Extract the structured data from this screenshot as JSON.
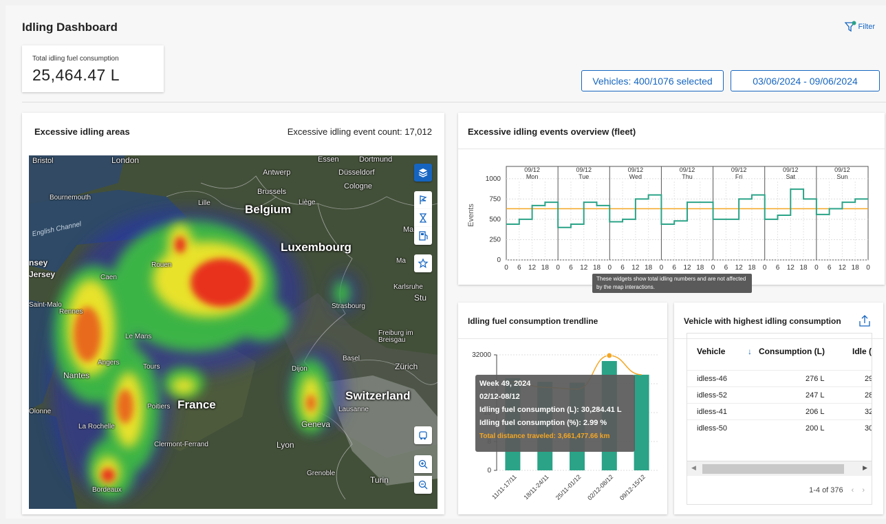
{
  "header": {
    "title": "Idling Dashboard",
    "filter_label": "Filter"
  },
  "kpi": {
    "label": "Total idling fuel consumption",
    "value": "25,464.47 L"
  },
  "selectors": {
    "vehicles": "Vehicles: 400/1076 selected",
    "date_range": "03/06/2024 - 09/06/2024"
  },
  "map": {
    "title": "Excessive idling areas",
    "event_count": "Excessive idling event count: 17,012",
    "countries": [
      "Belgium",
      "Luxembourg",
      "France",
      "Switzerland"
    ],
    "cities": [
      "Bristol",
      "London",
      "Antwerp",
      "Essen",
      "Dortmund",
      "Düsseldorf",
      "Cologne",
      "Brussels",
      "Lille",
      "Liège",
      "Bournemouth",
      "Rouen",
      "Caen",
      "Jersey",
      "nsey",
      "Saint-Malo",
      "Rennes",
      "Le Mans",
      "Angers",
      "Tours",
      "Nantes",
      "Poitiers",
      "La Rochelle",
      "Clermont-Ferrand",
      "Lyon",
      "Grenoble",
      "Turin",
      "Geneva",
      "Lausanne",
      "Dijon",
      "Basel",
      "Zürich",
      "Freiburg im Breisgau",
      "Strasbourg",
      "Karlsruhe",
      "Stu",
      "Bordeaux",
      "Olonne",
      "Ma",
      "Mar"
    ],
    "sea": "English Channel",
    "controls": [
      "layers-icon",
      "flag-icon",
      "hourglass-icon",
      "fuel-icon",
      "star-icon",
      "vehicle-icon",
      "zoom-in-icon",
      "zoom-out-icon"
    ]
  },
  "overview": {
    "title": "Excessive idling events overview (fleet)",
    "tooltip": "These widgets show total idling numbers and are not affected by the map interactions.",
    "colors": {
      "series": "#2aa387",
      "threshold": "#f5a623"
    }
  },
  "trend": {
    "title": "Idling fuel consumption trendline",
    "tooltip": {
      "week": "Week 49, 2024",
      "range": "02/12-08/12",
      "consumption_l": "Idling fuel consumption (L): 30,284.41 L",
      "consumption_pct": "Idling fuel consumption (%): 2.99 %",
      "distance": "Total distance traveled: 3,661,477.66 km"
    }
  },
  "vehicle_table": {
    "title": "Vehicle with highest idling consumption",
    "columns": [
      "Vehicle",
      "Consumption (L)",
      "Idle ("
    ],
    "sort_icon": "arrow-down-icon",
    "rows": [
      {
        "vehicle": "idless-46",
        "consumption": "276 L",
        "idle": "29"
      },
      {
        "vehicle": "idless-52",
        "consumption": "247 L",
        "idle": "28"
      },
      {
        "vehicle": "idless-41",
        "consumption": "206 L",
        "idle": "32"
      },
      {
        "vehicle": "idless-50",
        "consumption": "200 L",
        "idle": "30"
      }
    ],
    "pagination": "1-4 of 376"
  },
  "chart_data": [
    {
      "type": "line",
      "title": "Excessive idling events overview (fleet)",
      "ylabel": "Events",
      "ylim": [
        0,
        1100
      ],
      "yticks": [
        0,
        250,
        500,
        750,
        1000
      ],
      "xticks": [
        "0",
        "6",
        "12",
        "18"
      ],
      "days": [
        {
          "date": "09/12",
          "day": "Mon"
        },
        {
          "date": "09/12",
          "day": "Tue"
        },
        {
          "date": "09/12",
          "day": "Wed"
        },
        {
          "date": "09/12",
          "day": "Thu"
        },
        {
          "date": "09/12",
          "day": "Fri"
        },
        {
          "date": "09/12",
          "day": "Sat"
        },
        {
          "date": "09/12",
          "day": "Sun"
        }
      ],
      "threshold": 630,
      "series": [
        {
          "values": [
            440,
            500,
            670,
            710,
            400,
            440,
            710,
            670,
            470,
            500,
            750,
            800,
            440,
            480,
            710,
            710,
            500,
            500,
            750,
            800,
            500,
            550,
            870,
            750,
            560,
            630,
            710,
            750
          ]
        }
      ],
      "grid": true
    },
    {
      "type": "bar",
      "title": "Idling fuel consumption trendline",
      "categories": [
        "11/11-17/11",
        "18/11-24/11",
        "25/11-01/12",
        "02/12-08/12",
        "09/12-15/12"
      ],
      "values": [
        25500,
        24500,
        24300,
        30284.41,
        26500
      ],
      "line_values": [
        24500,
        23000,
        22500,
        31800,
        26500
      ],
      "ylim": [
        0,
        32000
      ],
      "yticks": [
        "0",
        "8",
        "16",
        "24",
        "32000"
      ],
      "grid": true
    }
  ]
}
